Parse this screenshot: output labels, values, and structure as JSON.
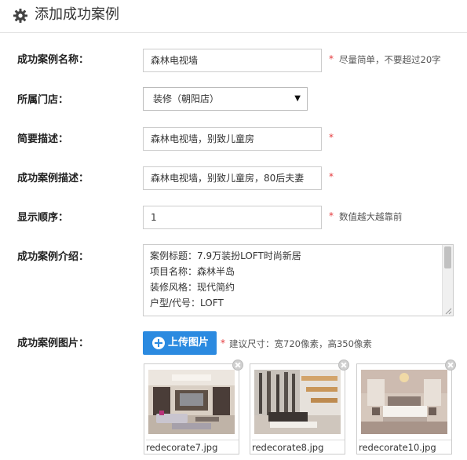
{
  "header": {
    "title": "添加成功案例",
    "icon": "gear-icon"
  },
  "form": {
    "name": {
      "label": "成功案例名称：",
      "value": "森林电视墙",
      "required": "*",
      "hint": "尽量简单，不要超过20字"
    },
    "store": {
      "label": "所属门店：",
      "selected": "装修（朝阳店）"
    },
    "summary": {
      "label": "简要描述：",
      "value": "森林电视墙，别致儿童房",
      "required": "*"
    },
    "description": {
      "label": "成功案例描述：",
      "value": "森林电视墙，别致儿童房，80后夫妻",
      "required": "*"
    },
    "order": {
      "label": "显示顺序：",
      "value": "1",
      "required": "*",
      "hint": "数值越大越靠前"
    },
    "intro": {
      "label": "成功案例介绍：",
      "lines": [
        "案例标题：7.9万装扮LOFT时尚新居",
        "项目名称：森林半岛",
        "装修风格：现代简约",
        "户型/代号：LOFT"
      ]
    },
    "images": {
      "label": "成功案例图片：",
      "upload_label": "上传图片",
      "required": "*",
      "hint": "建议尺寸：宽720像素，高350像素",
      "files": [
        "redecorate7.jpg",
        "redecorate8.jpg",
        "redecorate10.jpg"
      ]
    }
  },
  "colors": {
    "accent": "#2b8ae0",
    "required": "#e4393c"
  }
}
